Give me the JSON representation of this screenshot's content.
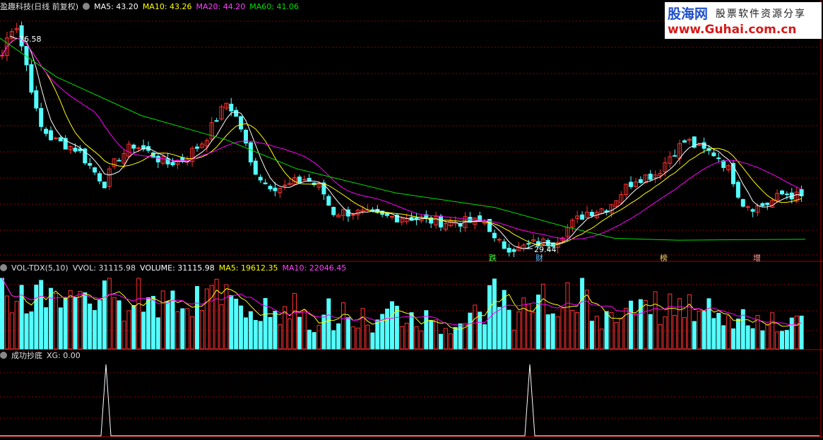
{
  "price_panel": {
    "title": "盈趣科技(日线 前复权)",
    "ma5": "MA5: 43.20",
    "ma10": "MA10: 43.26",
    "ma20": "MA20: 44.20",
    "ma60": "MA60: 41.06",
    "high_label": "76.58",
    "low_label": "29.44",
    "event_labels": [
      "跌",
      "财",
      "榜",
      "增"
    ]
  },
  "volume_panel": {
    "title": "VOL-TDX(5,10)",
    "vvol": "VVOL: 31115.98",
    "volume": "VOLUME: 31115.98",
    "ma5": "MA5: 19612.35",
    "ma10": "MA10: 22046.45"
  },
  "signal_panel": {
    "title": "成功抄底",
    "xg": "XG: 0.00"
  },
  "logo": {
    "brand": "股海网",
    "slogan": "股票软件资源分享",
    "url": "www.Guhai.com.cn"
  },
  "colors": {
    "up": "#ff3232",
    "down": "#54ffff",
    "ma5": "#ffffff",
    "ma10": "#ffff00",
    "ma20": "#ff00ff",
    "ma60": "#00e000",
    "grid": "#8b0000",
    "signal": "#ffffff"
  },
  "chart_data": [
    {
      "type": "candlestick",
      "title": "盈趣科技(日线 前复权)",
      "series": [
        {
          "name": "MA5",
          "values": [
            43.2
          ]
        },
        {
          "name": "MA10",
          "values": [
            43.26
          ]
        },
        {
          "name": "MA20",
          "values": [
            44.2
          ]
        },
        {
          "name": "MA60",
          "values": [
            41.06
          ]
        }
      ],
      "annotations": [
        {
          "text": "76.58",
          "kind": "period-high"
        },
        {
          "text": "29.44",
          "kind": "period-low"
        }
      ],
      "grid": true
    },
    {
      "type": "bar",
      "title": "VOL-TDX(5,10)",
      "series": [
        {
          "name": "VVOL",
          "values": [
            31115.98
          ]
        },
        {
          "name": "VOLUME",
          "values": [
            31115.98
          ]
        },
        {
          "name": "MA5",
          "values": [
            19612.35
          ]
        },
        {
          "name": "MA10",
          "values": [
            22046.45
          ]
        }
      ]
    },
    {
      "type": "line",
      "title": "成功抄底",
      "series": [
        {
          "name": "XG",
          "values": [
            0.0
          ]
        }
      ]
    }
  ]
}
